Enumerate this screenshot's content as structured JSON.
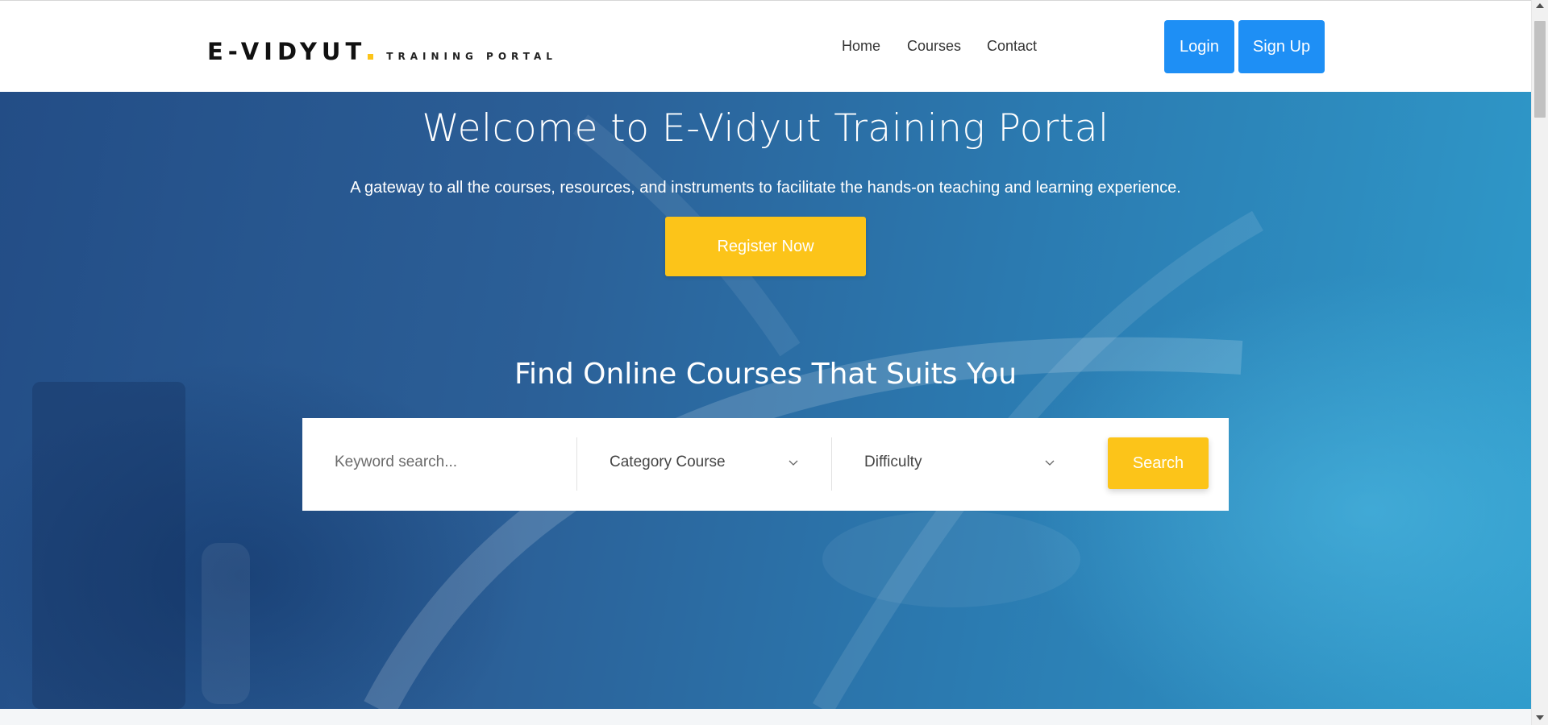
{
  "header": {
    "logo_main": "E-VIDYUT",
    "logo_sub": "TRAINING PORTAL",
    "nav": [
      "Home",
      "Courses",
      "Contact"
    ],
    "login_label": "Login",
    "signup_label": "Sign Up"
  },
  "hero": {
    "title": "Welcome to E-Vidyut Training Portal",
    "subtitle": "A gateway to all the courses, resources, and instruments to facilitate the hands-on teaching and learning experience.",
    "register_label": "Register Now"
  },
  "finder": {
    "title": "Find Online Courses That Suits You",
    "keyword_placeholder": "Keyword search...",
    "category_label": "Category Course",
    "difficulty_label": "Difficulty",
    "search_label": "Search"
  },
  "colors": {
    "accent_yellow": "#fcc419",
    "accent_blue": "#1e8ff5",
    "hero_blue_dark": "#234d86",
    "hero_blue_light": "#2f9bcb"
  },
  "icons": {
    "select_arrow": "chevron-down-icon"
  }
}
